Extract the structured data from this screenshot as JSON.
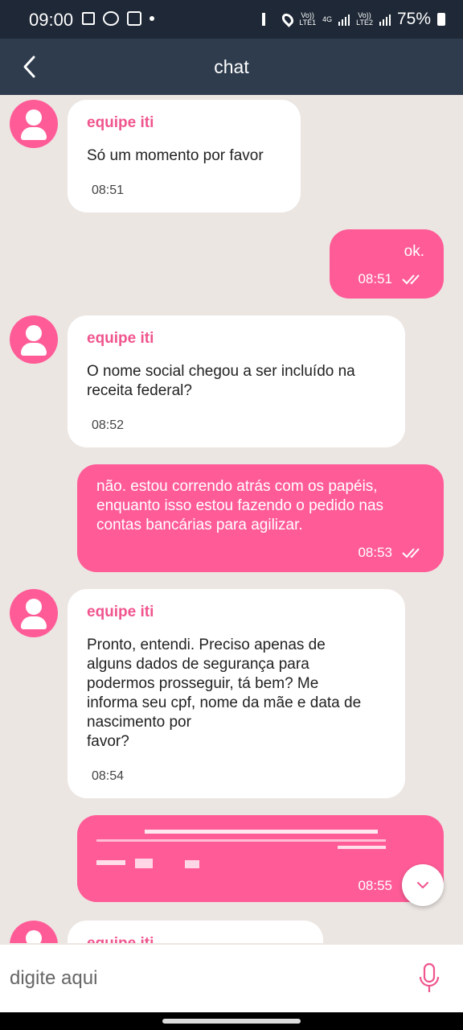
{
  "status_bar": {
    "time": "09:00",
    "network_1": "Vo))\nLTE1",
    "network_type": "4G",
    "network_2": "Vo))\nLTE2",
    "battery": "75%"
  },
  "header": {
    "title": "chat"
  },
  "messages": [
    {
      "sender": "equipe iti",
      "text": "Só um momento por favor",
      "time": "08:51"
    },
    {
      "text": "ok.",
      "time": "08:51"
    },
    {
      "sender": "equipe iti",
      "text": "O nome social chegou a ser incluído na\nreceita federal?",
      "time": "08:52"
    },
    {
      "text": "não. estou correndo atrás com os papéis,\nenquanto isso estou fazendo o pedido nas\ncontas bancárias para agilizar.",
      "time": "08:53"
    },
    {
      "sender": "equipe iti",
      "text": "Pronto, entendi. Preciso apenas de\nalguns dados de segurança para\npodermos prosseguir, tá bem? Me\ninforma seu cpf, nome da mãe e data de\nnascimento por\nfavor?",
      "time": "08:54"
    },
    {
      "text": "",
      "time": "08:55"
    },
    {
      "sender": "equipe iti"
    }
  ],
  "composer": {
    "placeholder": "digite aqui"
  },
  "colors": {
    "accent": "#ff5c97",
    "header_bg": "#2e3c4e",
    "status_bg": "#1e2836",
    "chat_bg": "#ece6e3"
  },
  "icons": [
    "back-arrow-icon",
    "avatar-icon",
    "double-check-icon",
    "chevron-down-icon",
    "microphone-icon"
  ]
}
